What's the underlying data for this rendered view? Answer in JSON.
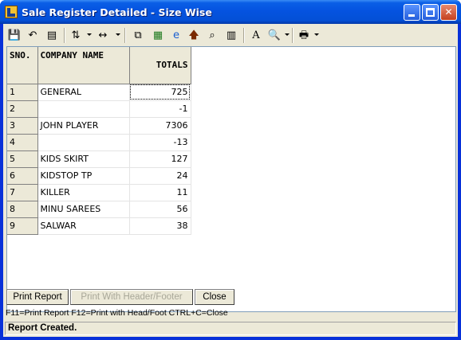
{
  "window": {
    "title": "Sale Register Detailed - Size Wise"
  },
  "toolbar": {
    "icons": [
      "save-icon",
      "undo-icon",
      "print-preview-icon",
      "sort-icon",
      "column-width-icon",
      "copy-icon",
      "excel-icon",
      "internet-explorer-icon",
      "up-arrow-icon",
      "find-icon",
      "chart-icon",
      "font-icon",
      "zoom-icon",
      "printer-icon"
    ]
  },
  "grid": {
    "headers": {
      "sno": "SNO.",
      "company": "COMPANY NAME",
      "totals": "TOTALS"
    },
    "rows": [
      {
        "sno": "1",
        "company": "GENERAL",
        "total": "725"
      },
      {
        "sno": "2",
        "company": "",
        "total": "-1"
      },
      {
        "sno": "3",
        "company": "JOHN PLAYER",
        "total": "7306"
      },
      {
        "sno": "4",
        "company": "",
        "total": "-13"
      },
      {
        "sno": "5",
        "company": "KIDS SKIRT",
        "total": "127"
      },
      {
        "sno": "6",
        "company": "KIDSTOP TP",
        "total": "24"
      },
      {
        "sno": "7",
        "company": "KILLER",
        "total": "11"
      },
      {
        "sno": "8",
        "company": "MINU SAREES",
        "total": "56"
      },
      {
        "sno": "9",
        "company": "SALWAR",
        "total": "38"
      }
    ]
  },
  "buttons": {
    "print_report": "Print Report",
    "print_header_footer": "Print With Header/Footer",
    "close": "Close"
  },
  "hint": "F11=Print Report  F12=Print with Head/Foot  CTRL+C=Close",
  "status": "Report Created."
}
